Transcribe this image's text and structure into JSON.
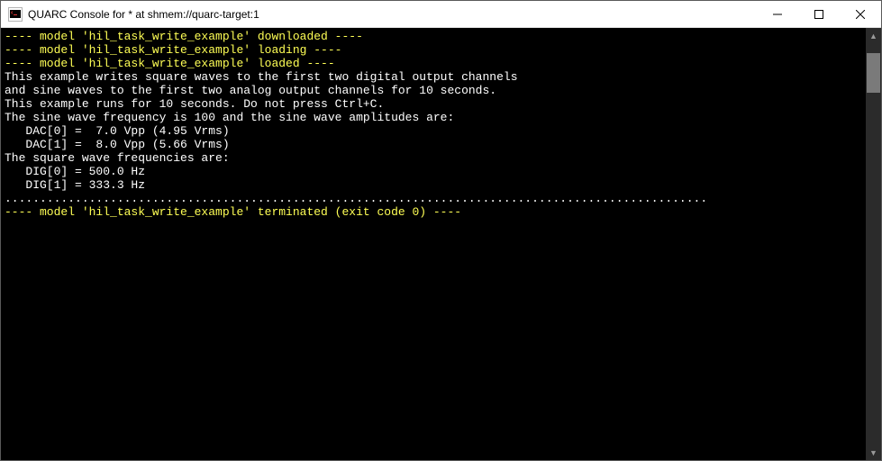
{
  "window": {
    "title": "QUARC Console for * at shmem://quarc-target:1",
    "icon_name": "quarc-console-icon",
    "buttons": {
      "minimize_label": "Minimize",
      "maximize_label": "Maximize",
      "close_label": "Close"
    }
  },
  "colors": {
    "background": "#000000",
    "text_default": "#ffffff",
    "text_highlight": "#ffff55"
  },
  "console": {
    "lines": [
      {
        "text": "",
        "kind": "plain"
      },
      {
        "text": "---- model 'hil_task_write_example' downloaded ----",
        "kind": "highlight"
      },
      {
        "text": "---- model 'hil_task_write_example' loading ----",
        "kind": "highlight"
      },
      {
        "text": "---- model 'hil_task_write_example' loaded ----",
        "kind": "highlight"
      },
      {
        "text": "",
        "kind": "plain"
      },
      {
        "text": "This example writes square waves to the first two digital output channels",
        "kind": "plain"
      },
      {
        "text": "and sine waves to the first two analog output channels for 10 seconds.",
        "kind": "plain"
      },
      {
        "text": "This example runs for 10 seconds. Do not press Ctrl+C.",
        "kind": "plain"
      },
      {
        "text": "The sine wave frequency is 100 and the sine wave amplitudes are:",
        "kind": "plain"
      },
      {
        "text": "   DAC[0] =  7.0 Vpp (4.95 Vrms)",
        "kind": "plain"
      },
      {
        "text": "   DAC[1] =  8.0 Vpp (5.66 Vrms)",
        "kind": "plain"
      },
      {
        "text": "The square wave frequencies are:",
        "kind": "plain"
      },
      {
        "text": "   DIG[0] = 500.0 Hz",
        "kind": "plain"
      },
      {
        "text": "   DIG[1] = 333.3 Hz",
        "kind": "plain"
      },
      {
        "text": "....................................................................................................",
        "kind": "plain"
      },
      {
        "text": "",
        "kind": "plain"
      },
      {
        "text": "",
        "kind": "plain"
      },
      {
        "text": "---- model 'hil_task_write_example' terminated (exit code 0) ----",
        "kind": "highlight"
      }
    ]
  },
  "scrollbar": {
    "orientation": "vertical",
    "thumb_position_fraction": 0.06,
    "thumb_size_fraction": 0.09
  }
}
